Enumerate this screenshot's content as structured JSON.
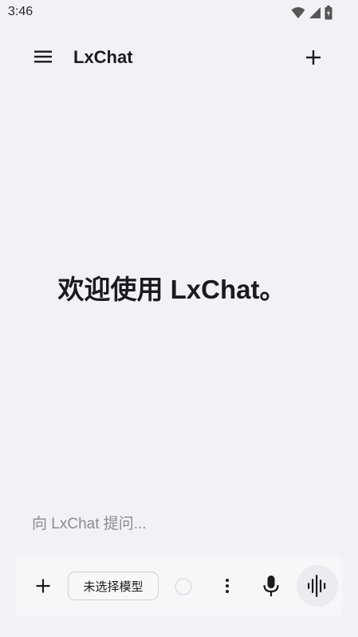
{
  "status_bar": {
    "time": "3:46",
    "icons": [
      "wifi-icon",
      "signal-icon",
      "battery-icon"
    ]
  },
  "app_bar": {
    "title": "LxChat",
    "menu_icon": "menu-icon",
    "new_chat_icon": "plus-icon"
  },
  "main": {
    "welcome_text": "欢迎使用 LxChat。"
  },
  "composer": {
    "placeholder": "向 LxChat 提问...",
    "value": ""
  },
  "toolbar": {
    "attach_icon": "plus-icon",
    "model_label": "未选择模型",
    "more_icon": "more-vertical-icon",
    "mic_icon": "microphone-icon",
    "voice_icon": "voice-waveform-icon"
  }
}
